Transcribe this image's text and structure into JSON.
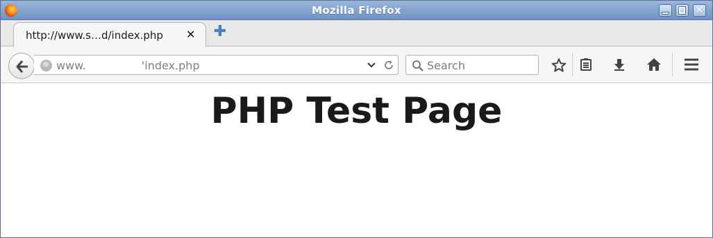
{
  "window": {
    "title": "Mozilla Firefox"
  },
  "tabs": [
    {
      "title": "http://www.s…d/index.php"
    }
  ],
  "navbar": {
    "url_prefix": "www.",
    "url_suffix": "'index.php",
    "search_placeholder": "Search"
  },
  "page": {
    "heading": "PHP Test Page"
  },
  "colors": {
    "titlebar": "#7ea0cf",
    "new_tab_plus": "#4a7fc6",
    "heading": "#1a1a1a"
  }
}
